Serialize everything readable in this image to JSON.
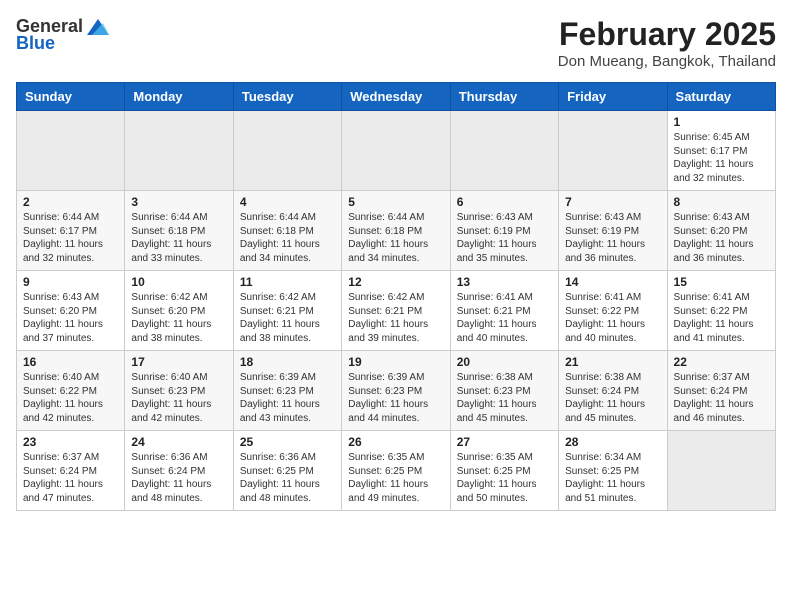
{
  "header": {
    "logo_general": "General",
    "logo_blue": "Blue",
    "title": "February 2025",
    "subtitle": "Don Mueang, Bangkok, Thailand"
  },
  "weekdays": [
    "Sunday",
    "Monday",
    "Tuesday",
    "Wednesday",
    "Thursday",
    "Friday",
    "Saturday"
  ],
  "weeks": [
    [
      {
        "day": "",
        "empty": true
      },
      {
        "day": "",
        "empty": true
      },
      {
        "day": "",
        "empty": true
      },
      {
        "day": "",
        "empty": true
      },
      {
        "day": "",
        "empty": true
      },
      {
        "day": "",
        "empty": true
      },
      {
        "day": "1",
        "sunrise": "6:45 AM",
        "sunset": "6:17 PM",
        "daylight": "11 hours and 32 minutes."
      }
    ],
    [
      {
        "day": "2",
        "sunrise": "6:44 AM",
        "sunset": "6:17 PM",
        "daylight": "11 hours and 32 minutes."
      },
      {
        "day": "3",
        "sunrise": "6:44 AM",
        "sunset": "6:18 PM",
        "daylight": "11 hours and 33 minutes."
      },
      {
        "day": "4",
        "sunrise": "6:44 AM",
        "sunset": "6:18 PM",
        "daylight": "11 hours and 34 minutes."
      },
      {
        "day": "5",
        "sunrise": "6:44 AM",
        "sunset": "6:18 PM",
        "daylight": "11 hours and 34 minutes."
      },
      {
        "day": "6",
        "sunrise": "6:43 AM",
        "sunset": "6:19 PM",
        "daylight": "11 hours and 35 minutes."
      },
      {
        "day": "7",
        "sunrise": "6:43 AM",
        "sunset": "6:19 PM",
        "daylight": "11 hours and 36 minutes."
      },
      {
        "day": "8",
        "sunrise": "6:43 AM",
        "sunset": "6:20 PM",
        "daylight": "11 hours and 36 minutes."
      }
    ],
    [
      {
        "day": "9",
        "sunrise": "6:43 AM",
        "sunset": "6:20 PM",
        "daylight": "11 hours and 37 minutes."
      },
      {
        "day": "10",
        "sunrise": "6:42 AM",
        "sunset": "6:20 PM",
        "daylight": "11 hours and 38 minutes."
      },
      {
        "day": "11",
        "sunrise": "6:42 AM",
        "sunset": "6:21 PM",
        "daylight": "11 hours and 38 minutes."
      },
      {
        "day": "12",
        "sunrise": "6:42 AM",
        "sunset": "6:21 PM",
        "daylight": "11 hours and 39 minutes."
      },
      {
        "day": "13",
        "sunrise": "6:41 AM",
        "sunset": "6:21 PM",
        "daylight": "11 hours and 40 minutes."
      },
      {
        "day": "14",
        "sunrise": "6:41 AM",
        "sunset": "6:22 PM",
        "daylight": "11 hours and 40 minutes."
      },
      {
        "day": "15",
        "sunrise": "6:41 AM",
        "sunset": "6:22 PM",
        "daylight": "11 hours and 41 minutes."
      }
    ],
    [
      {
        "day": "16",
        "sunrise": "6:40 AM",
        "sunset": "6:22 PM",
        "daylight": "11 hours and 42 minutes."
      },
      {
        "day": "17",
        "sunrise": "6:40 AM",
        "sunset": "6:23 PM",
        "daylight": "11 hours and 42 minutes."
      },
      {
        "day": "18",
        "sunrise": "6:39 AM",
        "sunset": "6:23 PM",
        "daylight": "11 hours and 43 minutes."
      },
      {
        "day": "19",
        "sunrise": "6:39 AM",
        "sunset": "6:23 PM",
        "daylight": "11 hours and 44 minutes."
      },
      {
        "day": "20",
        "sunrise": "6:38 AM",
        "sunset": "6:23 PM",
        "daylight": "11 hours and 45 minutes."
      },
      {
        "day": "21",
        "sunrise": "6:38 AM",
        "sunset": "6:24 PM",
        "daylight": "11 hours and 45 minutes."
      },
      {
        "day": "22",
        "sunrise": "6:37 AM",
        "sunset": "6:24 PM",
        "daylight": "11 hours and 46 minutes."
      }
    ],
    [
      {
        "day": "23",
        "sunrise": "6:37 AM",
        "sunset": "6:24 PM",
        "daylight": "11 hours and 47 minutes."
      },
      {
        "day": "24",
        "sunrise": "6:36 AM",
        "sunset": "6:24 PM",
        "daylight": "11 hours and 48 minutes."
      },
      {
        "day": "25",
        "sunrise": "6:36 AM",
        "sunset": "6:25 PM",
        "daylight": "11 hours and 48 minutes."
      },
      {
        "day": "26",
        "sunrise": "6:35 AM",
        "sunset": "6:25 PM",
        "daylight": "11 hours and 49 minutes."
      },
      {
        "day": "27",
        "sunrise": "6:35 AM",
        "sunset": "6:25 PM",
        "daylight": "11 hours and 50 minutes."
      },
      {
        "day": "28",
        "sunrise": "6:34 AM",
        "sunset": "6:25 PM",
        "daylight": "11 hours and 51 minutes."
      },
      {
        "day": "",
        "empty": true
      }
    ]
  ],
  "labels": {
    "sunrise": "Sunrise:",
    "sunset": "Sunset:",
    "daylight": "Daylight hours"
  }
}
